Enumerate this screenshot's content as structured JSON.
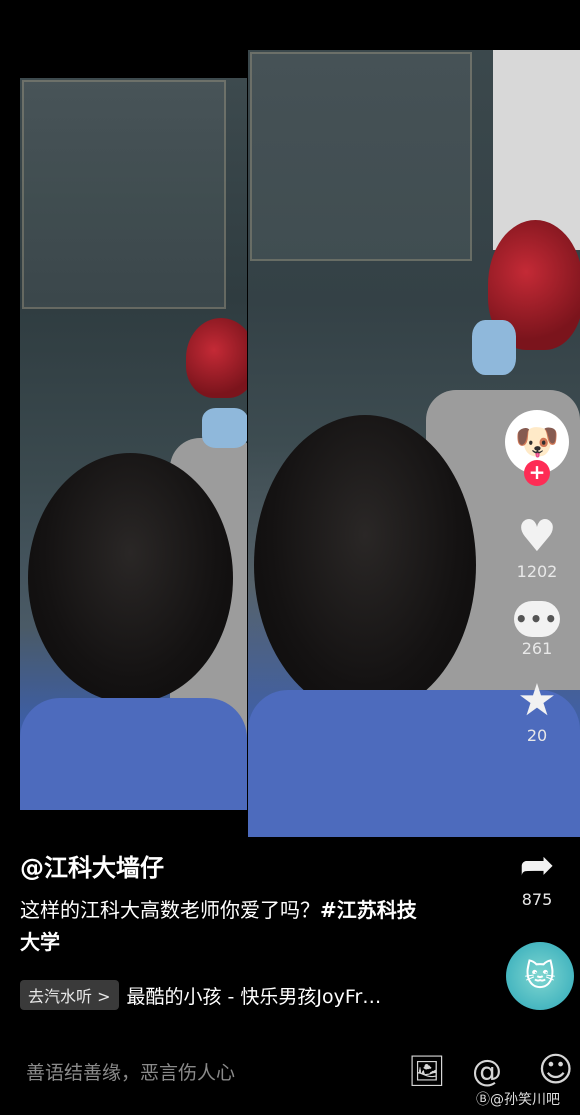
{
  "post": {
    "username": "@江科大墙仔",
    "caption": "这样的江科大高数老师你爱了吗？",
    "hashtag": "#江苏科技大学"
  },
  "actions": {
    "avatar_emoji": "🐶",
    "follow_symbol": "+",
    "like_icon": "♥",
    "like_count": "1202",
    "comment_count": "261",
    "favorite_icon": "★",
    "favorite_count": "20",
    "share_icon": "➦",
    "share_count": "875"
  },
  "music": {
    "chip_label": "去汽水听 >",
    "title": "最酷的小孩 - 快乐男孩JoyFr…",
    "disc_emoji": "🐱"
  },
  "bottom": {
    "comment_placeholder": "善语结善缘，恶言伤人心",
    "image_icon": "🖼",
    "at_icon": "@",
    "emoji_icon": "☺"
  },
  "watermark": "Ⓑ@孙笑川吧",
  "colors": {
    "accent": "#fe2c55",
    "background": "#000000",
    "shirt_blue": "#4d6bbd"
  }
}
